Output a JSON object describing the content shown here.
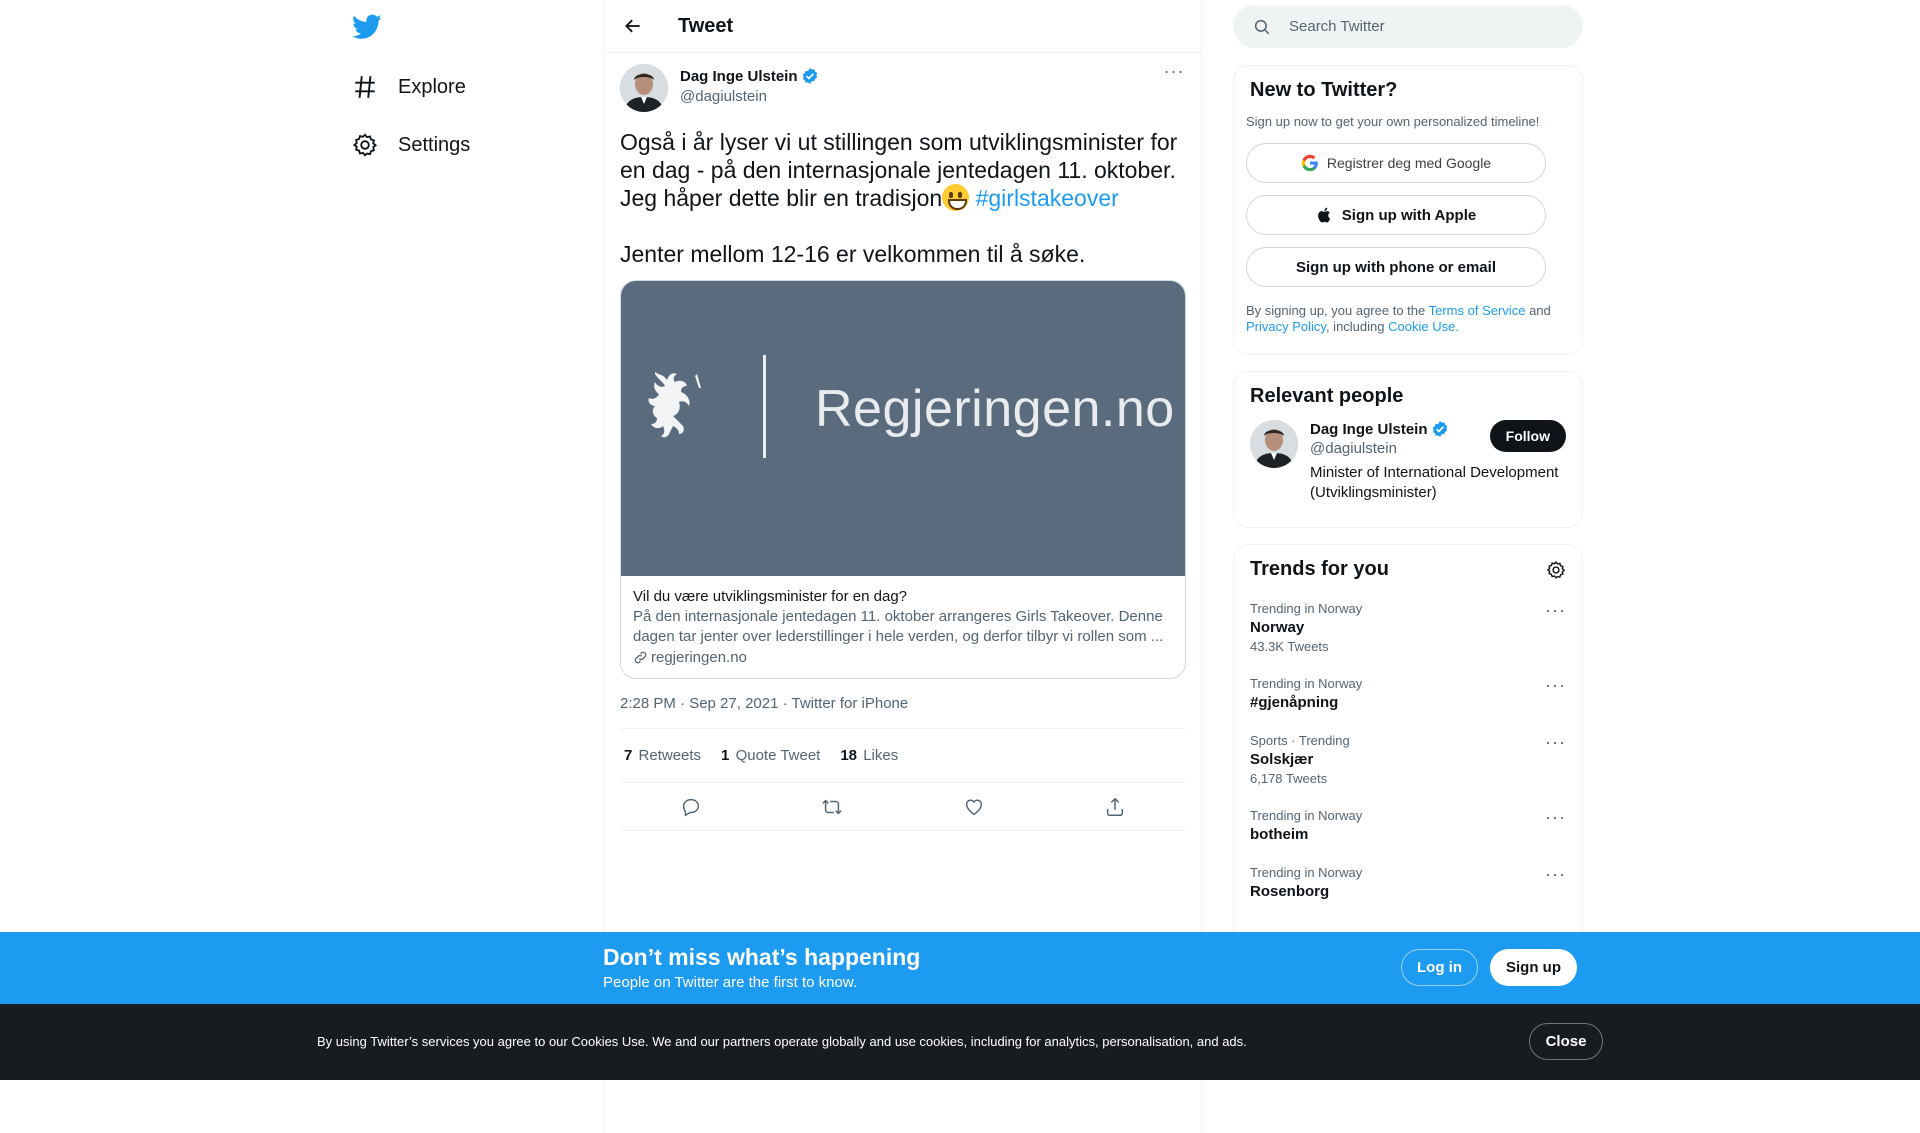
{
  "nav": {
    "logo_icon": "twitter-bird-icon",
    "items": [
      {
        "label": "Explore",
        "icon": "hashtag-icon"
      },
      {
        "label": "Settings",
        "icon": "gear-icon"
      }
    ]
  },
  "header": {
    "title": "Tweet"
  },
  "tweet": {
    "author_name": "Dag Inge Ulstein",
    "handle": "@dagiulstein",
    "text_part1": "Også i år lyser vi ut stillingen som utviklingsminister for en dag - på den internasjonale jentedagen 11. oktober. Jeg håper dette blir en tradisjon",
    "hashtag": "#girlstakeover",
    "text_part2": "Jenter mellom 12-16 er velkommen til å søke.",
    "card": {
      "brand": "Regjeringen.no",
      "title": "Vil du være utviklingsminister for en dag?",
      "description": "På den internasjonale jentedagen 11. oktober arrangeres Girls Takeover. Denne dagen tar jenter over lederstillinger i hele verden, og derfor tilbyr vi rollen som ...",
      "link": "regjeringen.no"
    },
    "meta": "2:28 PM · Sep 27, 2021 · Twitter for iPhone",
    "stats": {
      "retweets_count": "7",
      "retweets_label": "Retweets",
      "quotes_count": "1",
      "quotes_label": "Quote Tweet",
      "likes_count": "18",
      "likes_label": "Likes"
    }
  },
  "search": {
    "placeholder": "Search Twitter"
  },
  "new_panel": {
    "title": "New to Twitter?",
    "subtitle": "Sign up now to get your own personalized timeline!",
    "google_label": "Registrer deg med Google",
    "apple_label": "Sign up with Apple",
    "phone_label": "Sign up with phone or email",
    "legal_prefix": "By signing up, you agree to the",
    "tos": "Terms of Service",
    "and": "and",
    "privacy": "Privacy Policy",
    "including": ", including",
    "cookie": "Cookie Use."
  },
  "relevant": {
    "title": "Relevant people",
    "name": "Dag Inge Ulstein",
    "handle": "@dagiulstein",
    "bio": "Minister of International Development (Utviklingsminister)",
    "follow_label": "Follow"
  },
  "trends": {
    "title": "Trends for you",
    "items": [
      {
        "context": "Trending in Norway",
        "name": "Norway",
        "count": "43.3K Tweets"
      },
      {
        "context": "Trending in Norway",
        "name": "#gjenåpning",
        "count": ""
      },
      {
        "context": "Sports · Trending",
        "name": "Solskjær",
        "count": "6,178 Tweets"
      },
      {
        "context": "Trending in Norway",
        "name": "botheim",
        "count": ""
      },
      {
        "context": "Trending in Norway",
        "name": "Rosenborg",
        "count": ""
      }
    ]
  },
  "banner": {
    "title": "Don’t miss what’s happening",
    "subtitle": "People on Twitter are the first to know.",
    "login_label": "Log in",
    "signup_label": "Sign up"
  },
  "cookie": {
    "text": "By using Twitter’s services you agree to our Cookies Use. We and our partners operate globally and use cookies, including for analytics, personalisation, and ads.",
    "close_label": "Close"
  },
  "colors": {
    "accent": "#1d9bf0",
    "banner": "#1d9bf0",
    "cookie_bg": "#181b1f",
    "text": "#0f1419",
    "muted": "#536471"
  }
}
